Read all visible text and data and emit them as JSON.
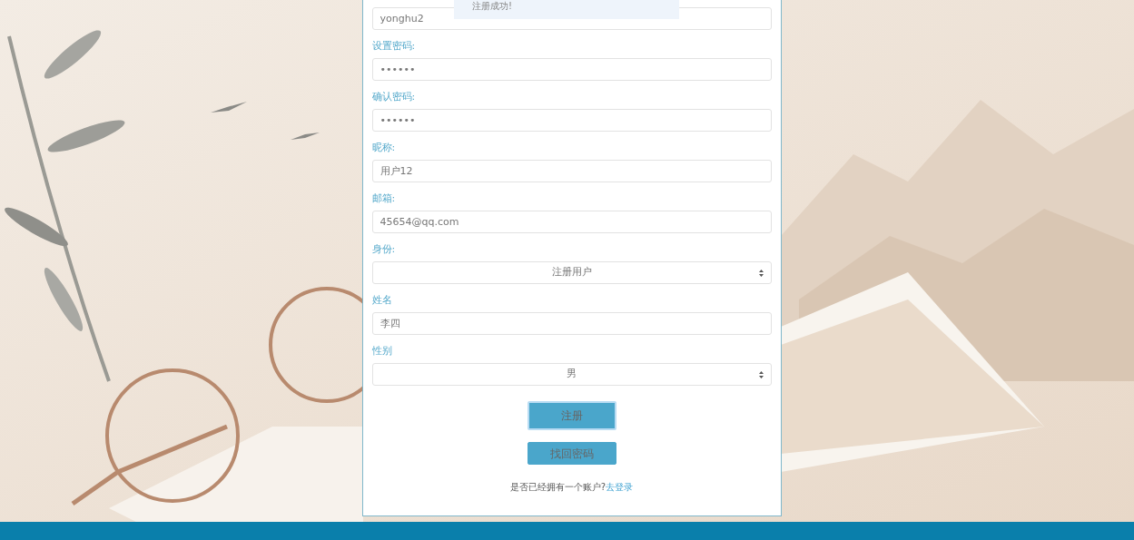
{
  "toast": {
    "message": "注册成功!"
  },
  "form": {
    "fields": [
      {
        "kind": "text",
        "value": "yonghu2"
      },
      {
        "kind": "text",
        "label": "设置密码:",
        "value": "••••••"
      },
      {
        "kind": "text",
        "label": "确认密码:",
        "value": "••••••"
      },
      {
        "kind": "text",
        "label": "昵称:",
        "value": "用户12"
      },
      {
        "kind": "text",
        "label": "邮箱:",
        "value": "45654@qq.com"
      },
      {
        "kind": "select",
        "label": "身份:",
        "value": "注册用户"
      },
      {
        "kind": "text",
        "label": "姓名",
        "value": "李四"
      },
      {
        "kind": "select",
        "label": "性别",
        "value": "男"
      }
    ],
    "buttons": [
      {
        "label": "注册",
        "focused": true
      },
      {
        "label": "找回密码",
        "focused": false
      }
    ],
    "footer": {
      "text": "是否已经拥有一个账户?",
      "link": "去登录"
    }
  }
}
